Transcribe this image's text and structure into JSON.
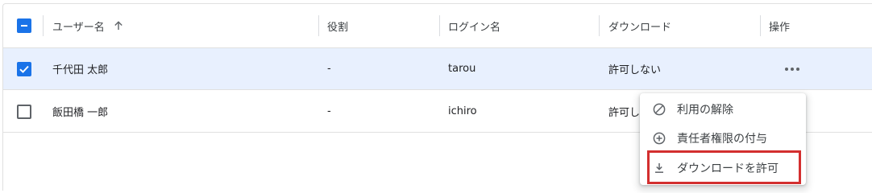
{
  "table": {
    "header": {
      "username": "ユーザー名",
      "role": "役割",
      "login": "ログイン名",
      "download": "ダウンロード",
      "actions": "操作"
    },
    "rows": [
      {
        "name": "千代田 太郎",
        "role": "-",
        "login": "tarou",
        "download": "許可しない",
        "selected": true
      },
      {
        "name": "飯田橋 一郎",
        "role": "-",
        "login": "ichiro",
        "download": "許可し",
        "selected": false
      }
    ]
  },
  "menu": {
    "items": [
      {
        "label": "利用の解除",
        "icon": "block-icon"
      },
      {
        "label": "責任者権限の付与",
        "icon": "add-circle-icon"
      },
      {
        "label": "ダウンロードを許可",
        "icon": "download-icon"
      }
    ]
  },
  "colors": {
    "accent": "#1a73e8",
    "selected_row": "#e8f0fe",
    "highlight": "#d32f2f"
  }
}
